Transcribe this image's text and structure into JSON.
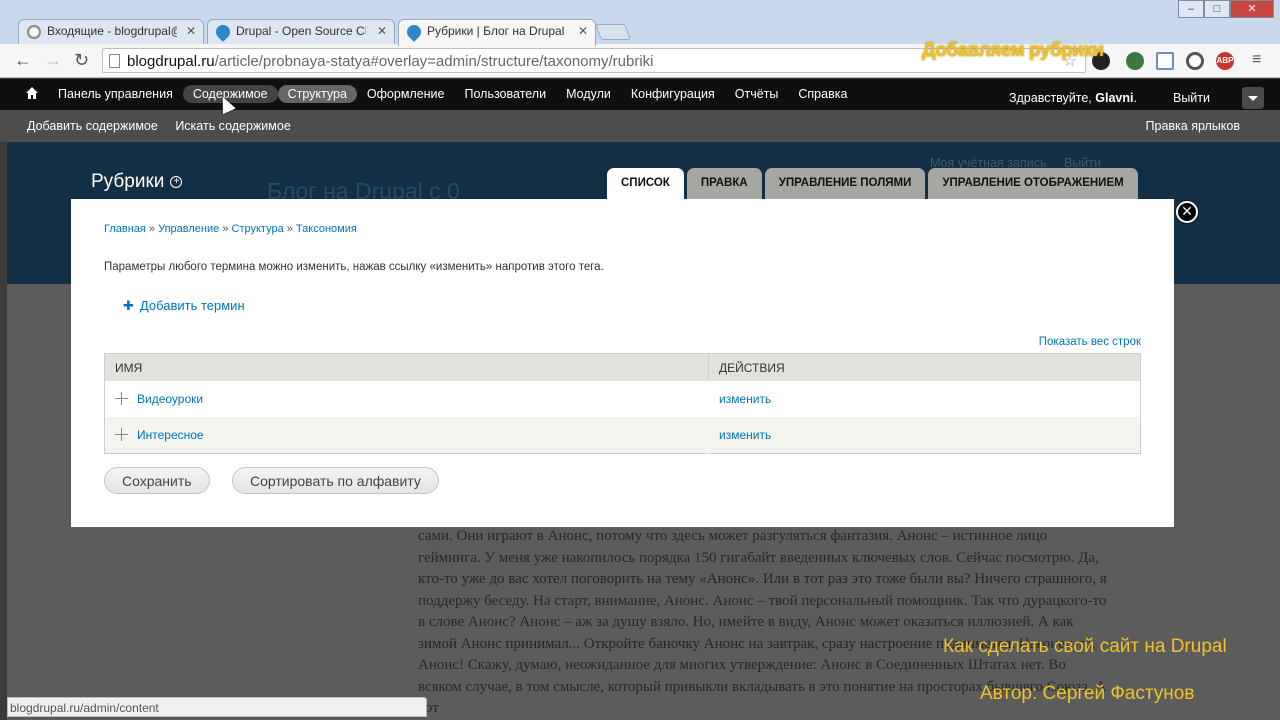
{
  "browser": {
    "tabs": [
      {
        "title": "Входящие - blogdrupal@",
        "icon": "gmail-icon"
      },
      {
        "title": "Drupal - Open Source CM",
        "icon": "drupal-icon"
      },
      {
        "title": "Рубрики | Блог на Drupal",
        "icon": "drupal-icon",
        "active": true
      }
    ],
    "url_host": "blogdrupal.ru",
    "url_path": "/article/probnaya-statya#overlay=admin/structure/taxonomy/rubriki"
  },
  "video_banner": "Добавляем рубрики",
  "admin_toolbar": {
    "menu": [
      "Панель управления",
      "Содержимое",
      "Структура",
      "Оформление",
      "Пользователи",
      "Модули",
      "Конфигурация",
      "Отчёты",
      "Справка"
    ],
    "greeting_prefix": "Здравствуйте,",
    "greeting_user": "Glavni",
    "logout": "Выйти"
  },
  "shortcuts": {
    "items": [
      "Добавить содержимое",
      "Искать содержимое"
    ],
    "edit": "Правка ярлыков"
  },
  "site": {
    "title": "Блог на Drupal с 0",
    "account_links": [
      "Моя учётная запись",
      "Выйти"
    ]
  },
  "overlay": {
    "title": "Рубрики",
    "tabs": [
      "Список",
      "Правка",
      "Управление полями",
      "Управление отображением"
    ],
    "breadcrumb": [
      "Главная",
      "Управление",
      "Структура",
      "Таксономия"
    ],
    "help_text": "Параметры любого термина можно изменить, нажав ссылку «изменить» напротив этого тега.",
    "add_term": "Добавить термин",
    "show_weights": "Показать вес строк",
    "table": {
      "columns": [
        "Имя",
        "Действия"
      ],
      "rows": [
        {
          "name": "Видеоуроки",
          "action": "изменить"
        },
        {
          "name": "Интересное",
          "action": "изменить"
        }
      ]
    },
    "save_button": "Сохранить",
    "sort_button": "Сортировать по алфавиту"
  },
  "background_text": "сами. Они играют в Анонс, потому что здесь может разгуляться фантазия. Анонс – истинное лицо гейминга. У меня уже накопилось порядка 150 гигабайт введенных ключевых слов. Сейчас посмотрю. Да, кто-то уже до вас хотел поговорить на тему «Анонс». Или в тот раз это тоже были вы? Ничего страшного, я поддержу беседу. На старт, внимание, Анонс. Анонс – твой персональный помощник. Так что дурацкого-то в слове Анонс? Анонс – аж за душу взяло. Но, имейте в виду, Анонс может оказаться иллюзией. А как зимой Анонс принимал... Откройте баночку Анонс на завтрак, сразу настроение поднимется. Наконец-то, Анонс! Скажу, думаю, неожиданное для многих утверждение: Анонс в Соединенных Штатах нет. Во всяком случае, в том смысле, который привыкли вкладывать в это понятие на просторах бывшего Союза. А вот",
  "status_url": "blogdrupal.ru/admin/content",
  "captions": {
    "line1": "Как сделать свой сайт на Drupal",
    "line2": "Автор: Сергей Фастунов"
  }
}
